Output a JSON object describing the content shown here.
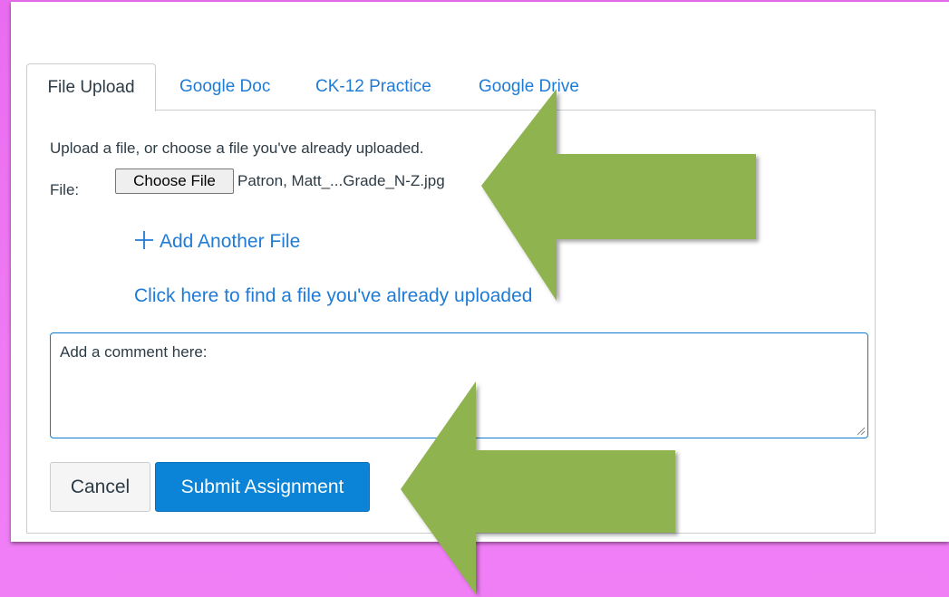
{
  "tabs": [
    {
      "label": "File Upload",
      "active": true
    },
    {
      "label": "Google Doc",
      "active": false
    },
    {
      "label": "CK-12 Practice",
      "active": false
    },
    {
      "label": "Google Drive",
      "active": false
    }
  ],
  "upload": {
    "instructions": "Upload a file, or choose a file you've already uploaded.",
    "file_label": "File:",
    "choose_button": "Choose File",
    "file_name": "Patron, Matt_...Grade_N-Z.jpg",
    "add_another": "Add Another File",
    "find_uploaded": "Click here to find a file you've already uploaded"
  },
  "comment": {
    "value": "Add a comment here:"
  },
  "actions": {
    "cancel_label": "Cancel",
    "submit_label": "Submit Assignment"
  },
  "colors": {
    "background": "#ee78f3",
    "link": "#1f7bd6",
    "submit": "#0b84d8",
    "arrow": "#8fb34f"
  },
  "icons": {
    "add_file": "plus-icon",
    "annotation": "arrow-icon"
  }
}
